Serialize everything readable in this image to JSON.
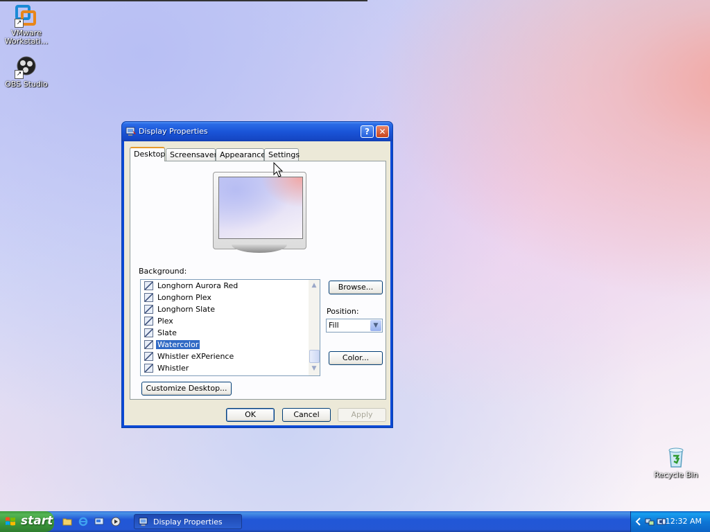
{
  "desktop": {
    "icons": [
      {
        "label": "VMware Workstati...",
        "icon": "vmware-icon"
      },
      {
        "label": "OBS Studio",
        "icon": "obs-icon"
      },
      {
        "label": "Recycle Bin",
        "icon": "recycle-bin-icon"
      }
    ]
  },
  "window": {
    "title": "Display Properties",
    "help_label": "?",
    "close_label": "✕",
    "tabs": [
      {
        "label": "Desktop",
        "active": true
      },
      {
        "label": "Screensaver",
        "active": false
      },
      {
        "label": "Appearance",
        "active": false
      },
      {
        "label": "Settings",
        "active": false
      }
    ],
    "background_label": "Background:",
    "backgrounds": [
      {
        "name": "Longhorn Aurora Red",
        "selected": false
      },
      {
        "name": "Longhorn Plex",
        "selected": false
      },
      {
        "name": "Longhorn Slate",
        "selected": false
      },
      {
        "name": "Plex",
        "selected": false
      },
      {
        "name": "Slate",
        "selected": false
      },
      {
        "name": "Watercolor",
        "selected": true
      },
      {
        "name": "Whistler eXPerience",
        "selected": false
      },
      {
        "name": "Whistler",
        "selected": false
      }
    ],
    "browse_label": "Browse...",
    "position_label": "Position:",
    "position_value": "Fill",
    "color_label": "Color...",
    "customize_label": "Customize Desktop...",
    "ok_label": "OK",
    "cancel_label": "Cancel",
    "apply_label": "Apply"
  },
  "taskbar": {
    "start_label": "start",
    "task_label": "Display Properties",
    "clock": "12:32 AM",
    "quick_launch": [
      "folder-icon",
      "internet-explorer-icon",
      "show-desktop-icon",
      "media-player-icon"
    ],
    "tray_icons": [
      "arrow-icon",
      "network-icon",
      "volume-icon"
    ]
  },
  "colors": {
    "accent": "#316ac5",
    "titlebar": "#1a55d8",
    "start_green": "#3c9a3c",
    "tab_highlight": "#e69a2b"
  }
}
